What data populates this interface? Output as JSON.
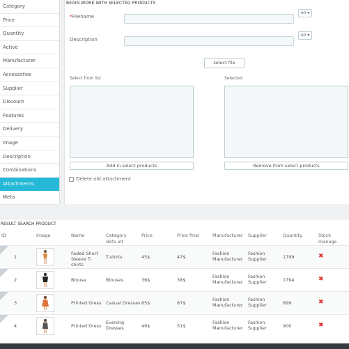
{
  "sidebar": {
    "items": [
      {
        "label": "Category"
      },
      {
        "label": "Price"
      },
      {
        "label": "Quantity"
      },
      {
        "label": "Active"
      },
      {
        "label": "Manufacturer"
      },
      {
        "label": "Accessories"
      },
      {
        "label": "Supplier"
      },
      {
        "label": "Discount"
      },
      {
        "label": "Features"
      },
      {
        "label": "Delivery"
      },
      {
        "label": "Image"
      },
      {
        "label": "Description"
      },
      {
        "label": "Combinations"
      },
      {
        "label": "Attachments",
        "active": true
      },
      {
        "label": "Meta"
      }
    ]
  },
  "form": {
    "heading": "BEGIN WORK WITH SELECTED PRODUCTS",
    "filename_required_mark": "*",
    "filename_label": "Filename",
    "filename_value": "",
    "description_label": "Description",
    "description_value": "",
    "lang": "en ▾",
    "select_file": "select file",
    "select_from_list": "Select from list",
    "selected": "Selected",
    "add_button": "Add in select products",
    "remove_button": "Remove from select products",
    "delete_old": "Delete old attachment",
    "delete_old_checked": false
  },
  "results": {
    "heading": "RESULT SEARCH PRODUCT",
    "columns": {
      "id": "ID",
      "image": "Image",
      "name": "Name",
      "category": "Category defa ult",
      "price": "Price",
      "price_final": "Price final",
      "manufacturer": "Manufacturer",
      "supplier": "Supplier",
      "quantity": "Quantity",
      "stock": "Stock manage ment"
    },
    "rows": [
      {
        "id": "1",
        "name": "Faded Short Sleeve T-shirts",
        "category": "T-shirts",
        "price": "45$",
        "price_final": "47$",
        "manufacturer": "Fashion Manufacturer",
        "supplier": "Fashion Supplier",
        "quantity": "1799",
        "stock": "✖",
        "figure_color": "#d98a3a"
      },
      {
        "id": "2",
        "name": "Blouse",
        "category": "Blouses",
        "price": "36$",
        "price_final": "38$",
        "manufacturer": "Fashion Manufacturer",
        "supplier": "Fashion Supplier",
        "quantity": "1794",
        "stock": "✖",
        "figure_color": "#222222"
      },
      {
        "id": "3",
        "name": "Printed Dress",
        "category": "Casual Dresses",
        "price": "65$",
        "price_final": "67$",
        "manufacturer": "Fashion Manufacturer",
        "supplier": "Fashion Supplier",
        "quantity": "899",
        "stock": "✖",
        "figure_color": "#d9743a"
      },
      {
        "id": "4",
        "name": "Printed Dress",
        "category": "Evening Dresses",
        "price": "49$",
        "price_final": "51$",
        "manufacturer": "Fashion Manufacturer",
        "supplier": "Fashion Supplier",
        "quantity": "900",
        "stock": "✖",
        "figure_color": "#555555"
      }
    ]
  },
  "colors": {
    "accent": "#25b9d7",
    "delete_x": "#e0302d"
  }
}
